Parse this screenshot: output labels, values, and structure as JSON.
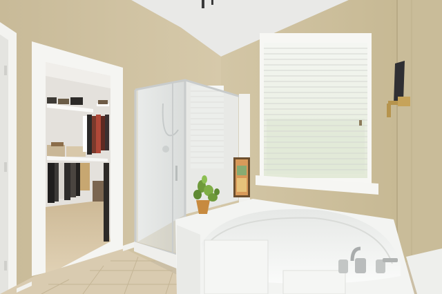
{
  "scene": {
    "caption": "",
    "colors": {
      "wall": "#cdbf9f",
      "wall_shadow": "#b9ac8c",
      "ceiling": "#e9e9e7",
      "trim": "#f4f4f1",
      "floor_tile": "#d9cbb0",
      "tub": "#f3f4f2",
      "glass": "#d9dcdc",
      "closet_wall": "#e6e3df",
      "window_light": "#eef1ea",
      "plant": "#6f9a3b",
      "pot": "#c78a3f"
    },
    "objects": [
      "walk-in-closet",
      "glass-shower",
      "window-with-blinds",
      "garden-tub",
      "potted-plant",
      "framed-art",
      "towel-hook",
      "ceiling-fan"
    ]
  }
}
